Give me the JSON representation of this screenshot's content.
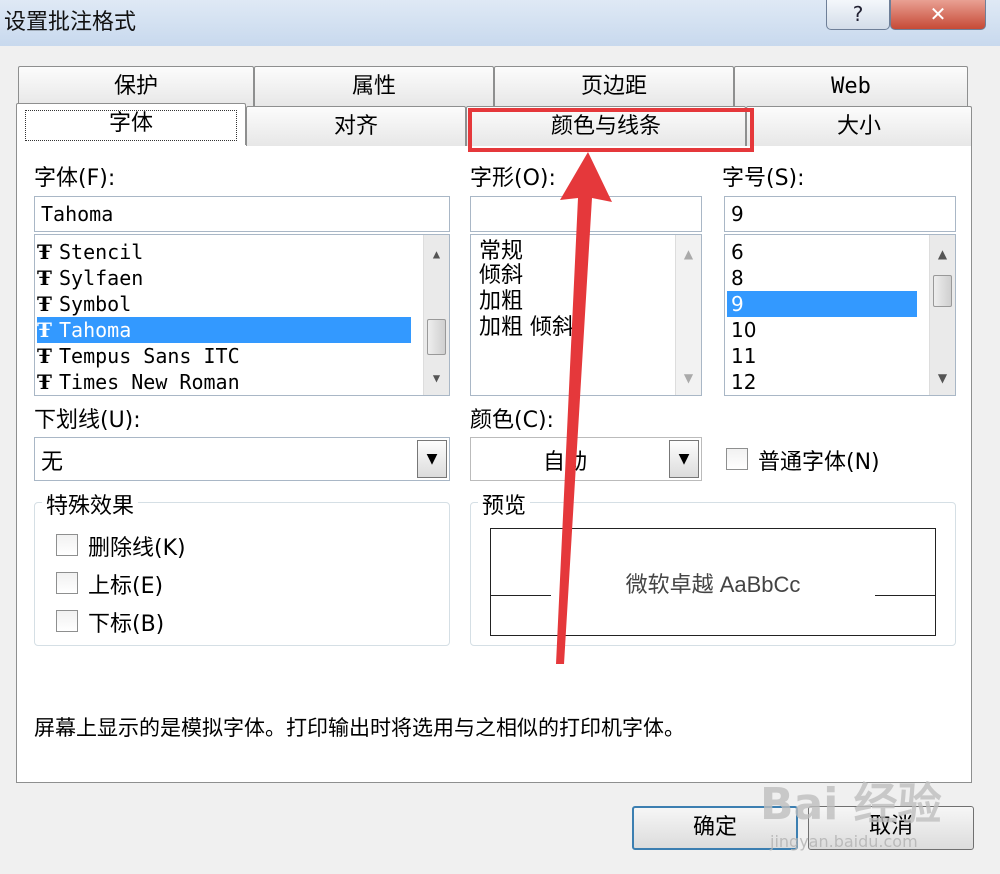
{
  "window": {
    "title": "设置批注格式",
    "help_glyph": "?",
    "close_glyph": "✕"
  },
  "tabs_back": [
    "保护",
    "属性",
    "页边距",
    "Web"
  ],
  "tabs_front": [
    "字体",
    "对齐",
    "颜色与线条",
    "大小"
  ],
  "font": {
    "label": "字体(F):",
    "value": "Tahoma",
    "items": [
      "Stencil",
      "Sylfaen",
      "Symbol",
      "Tahoma",
      "Tempus Sans ITC",
      "Times New Roman"
    ],
    "selected": "Tahoma",
    "icon": "truetype-icon"
  },
  "style": {
    "label": "字形(O):",
    "value": "",
    "items": [
      "常规",
      "倾斜",
      "加粗",
      "加粗 倾斜"
    ]
  },
  "size": {
    "label": "字号(S):",
    "value": "9",
    "items": [
      "6",
      "8",
      "9",
      "10",
      "11",
      "12"
    ],
    "selected": "9"
  },
  "underline": {
    "label": "下划线(U):",
    "value": "无"
  },
  "color": {
    "label": "颜色(C):",
    "value": "自动"
  },
  "normal_font": {
    "label": "普通字体(N)"
  },
  "effects": {
    "title": "特殊效果",
    "items": [
      "删除线(K)",
      "上标(E)",
      "下标(B)"
    ]
  },
  "preview": {
    "title": "预览",
    "sample": "微软卓越  AaBbCc"
  },
  "note": "屏幕上显示的是模拟字体。打印输出时将选用与之相似的打印机字体。",
  "buttons": {
    "ok": "确定",
    "cancel": "取消"
  },
  "watermark": {
    "logo": "Bai 经验",
    "url": "jingyan.baidu.com"
  },
  "annotation_color": "#e5383b",
  "selection_color": "#3399ff"
}
